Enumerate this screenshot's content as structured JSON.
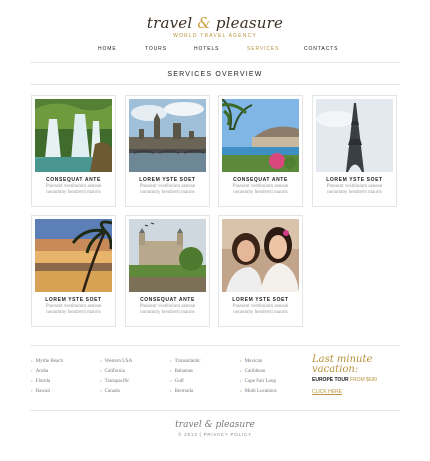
{
  "header": {
    "logo_part1": "travel",
    "logo_amp": "&",
    "logo_part2": "pleasure",
    "tagline": "WORLD TRAVEL AGENCY"
  },
  "nav": {
    "items": [
      "HOME",
      "TOURS",
      "HOTELS",
      "SERVICES",
      "CONTACTS"
    ],
    "active": "SERVICES"
  },
  "section_title": "SERVICES OVERVIEW",
  "cards": [
    {
      "title": "CONSEQUAT ANTE",
      "text": "Praesent vestibulum aenean nonummy hendrerit mauris",
      "image": "waterfall"
    },
    {
      "title": "LOREM YSTE SOET",
      "text": "Praesent vestibulum aenean nonummy hendrerit mauris",
      "image": "london-parliament"
    },
    {
      "title": "CONSEQUAT ANTE",
      "text": "Praesent vestibulum aenean nonummy hendrerit mauris",
      "image": "coastal-town"
    },
    {
      "title": "LOREM YSTE SOET",
      "text": "Praesent vestibulum aenean nonummy hendrerit mauris",
      "image": "eiffel-tower"
    },
    {
      "title": "LOREM YSTE SOET",
      "text": "Praesent vestibulum aenean nonummy hendrerit mauris",
      "image": "palm-beach-sunset"
    },
    {
      "title": "CONSEQUAT ANTE",
      "text": "Praesent vestibulum aenean nonummy hendrerit mauris",
      "image": "tower-of-london"
    },
    {
      "title": "LOREM YSTE SOET",
      "text": "Praesent vestibulum aenean nonummy hendrerit mauris",
      "image": "two-women-friends"
    }
  ],
  "footer": {
    "columns": [
      [
        "Myrtle Beach",
        "Aruba",
        "Florida",
        "Hawaii"
      ],
      [
        "Western USA",
        "California",
        "Transpacific",
        "Canada"
      ],
      [
        "Transatlantic",
        "Bahamas",
        "Gulf",
        "Bermuda"
      ],
      [
        "Mexican",
        "Caribbean",
        "Cape Fair Loop",
        "Multi Locations"
      ]
    ],
    "last_minute_line1": "Last minute",
    "last_minute_line2": "vacation:",
    "offer": "EUROPE TOUR",
    "offer_price": "FROM $690",
    "click_here": "CLICK HERE",
    "logo": "travel & pleasure",
    "copyright": "© 2013 | PRIVACY POLICY"
  },
  "colors": {
    "accent": "#b8923a",
    "text": "#222222",
    "muted": "#999999"
  }
}
